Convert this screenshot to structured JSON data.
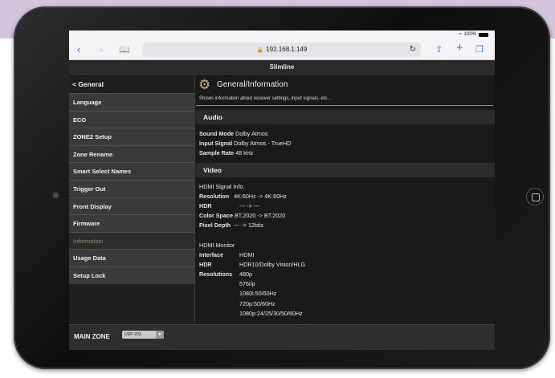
{
  "browser": {
    "battery": "100%",
    "url": "192.168.1.149"
  },
  "app": {
    "title": "Slimline"
  },
  "sidebar": {
    "back_label": "< General",
    "items": [
      {
        "label": "Language"
      },
      {
        "label": "ECO"
      },
      {
        "label": "ZONE2 Setup"
      },
      {
        "label": "Zone Rename"
      },
      {
        "label": "Smart Select Names"
      },
      {
        "label": "Trigger Out"
      },
      {
        "label": "Front Display"
      },
      {
        "label": "Firmware"
      },
      {
        "label": "Information"
      },
      {
        "label": "Usage Data"
      },
      {
        "label": "Setup Lock"
      }
    ],
    "active_item": "Information"
  },
  "main": {
    "title": "General/Information",
    "description": "Shows information about receiver settings, input signals, etc...",
    "audio": {
      "heading": "Audio",
      "sound_mode_label": "Sound Mode",
      "sound_mode_value": "Dolby Atmos",
      "input_signal_label": "Input Signal",
      "input_signal_value": "Dolby Atmos - TrueHD",
      "sample_rate_label": "Sample Rate",
      "sample_rate_value": "48 kHz"
    },
    "video": {
      "heading": "Video",
      "hdmi_signal_heading": "HDMI Signal Info.",
      "resolution_label": "Resolution",
      "resolution_value": "4K:60Hz -> 4K:60Hz",
      "hdr_label": "HDR",
      "hdr_value": "--- -> ---",
      "color_space_label": "Color Space",
      "color_space_value": "BT.2020 -> BT.2020",
      "pixel_depth_label": "Pixel Depth",
      "pixel_depth_value": "--- -> 12bits",
      "hdmi_monitor_heading": "HDMI Monitor",
      "interface_label": "Interface",
      "interface_value": "HDMI",
      "monitor_hdr_label": "HDR",
      "monitor_hdr_value": "HDR10/Dolby Vision/HLG",
      "resolutions_label": "Resolutions",
      "resolutions": [
        "480p",
        "576i/p",
        "1080i:50/60Hz",
        "720p:50/60Hz",
        "1080p:24/25/30/50/60Hz"
      ]
    }
  },
  "footer": {
    "zone_label": "MAIN ZONE",
    "zone_select_value": "UDP-203"
  }
}
